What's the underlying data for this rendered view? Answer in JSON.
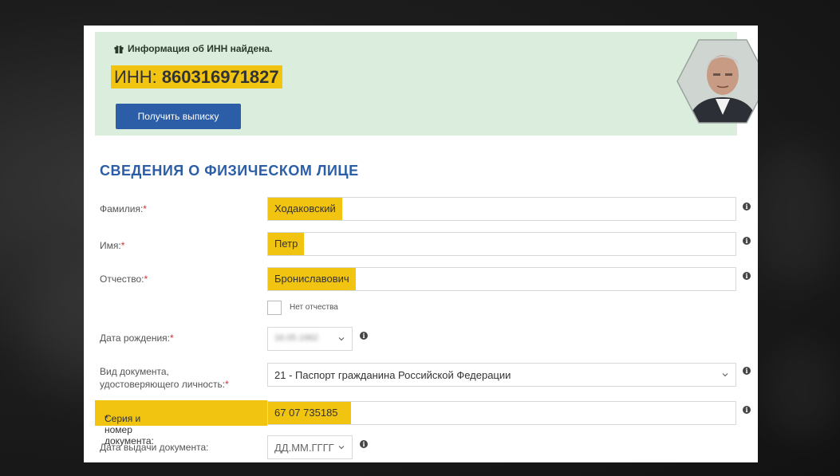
{
  "banner": {
    "message": "Информация об ИНН найдена.",
    "inn_prefix": "ИНН: ",
    "inn_number": "860316971827",
    "button_label": "Получить выписку"
  },
  "section_title": "СВЕДЕНИЯ О ФИЗИЧЕСКОМ ЛИЦЕ",
  "fields": {
    "surname": {
      "label": "Фамилия:",
      "required": "*",
      "value": "Ходаковский"
    },
    "name": {
      "label": "Имя:",
      "required": "*",
      "value": "Петр"
    },
    "patronymic": {
      "label": "Отчество:",
      "required": "*",
      "value": "Брониславович"
    },
    "no_patronymic": {
      "label": "Нет отчества",
      "checked": false
    },
    "birth_date": {
      "label": "Дата рождения:",
      "required": "*",
      "value": "16.05.1962"
    },
    "doc_type": {
      "label_line1": "Вид документа,",
      "label_line2": "удостоверяющего личность:",
      "required": "*",
      "value": "21 - Паспорт гражданина Российской Федерации"
    },
    "doc_number": {
      "label": "Серия и номер документа:",
      "required": "*",
      "value": "67 07 735185"
    },
    "issue_date": {
      "label": "Дата выдачи документа:",
      "placeholder": "ДД.ММ.ГГГГ"
    }
  },
  "colors": {
    "accent": "#2b5ea6",
    "highlight": "#f2c412",
    "banner_bg": "#dbeedd",
    "required": "#d03030"
  },
  "icons": {
    "info": "info-circle-icon",
    "chevron": "chevron-down-icon",
    "gift": "gift-icon"
  }
}
